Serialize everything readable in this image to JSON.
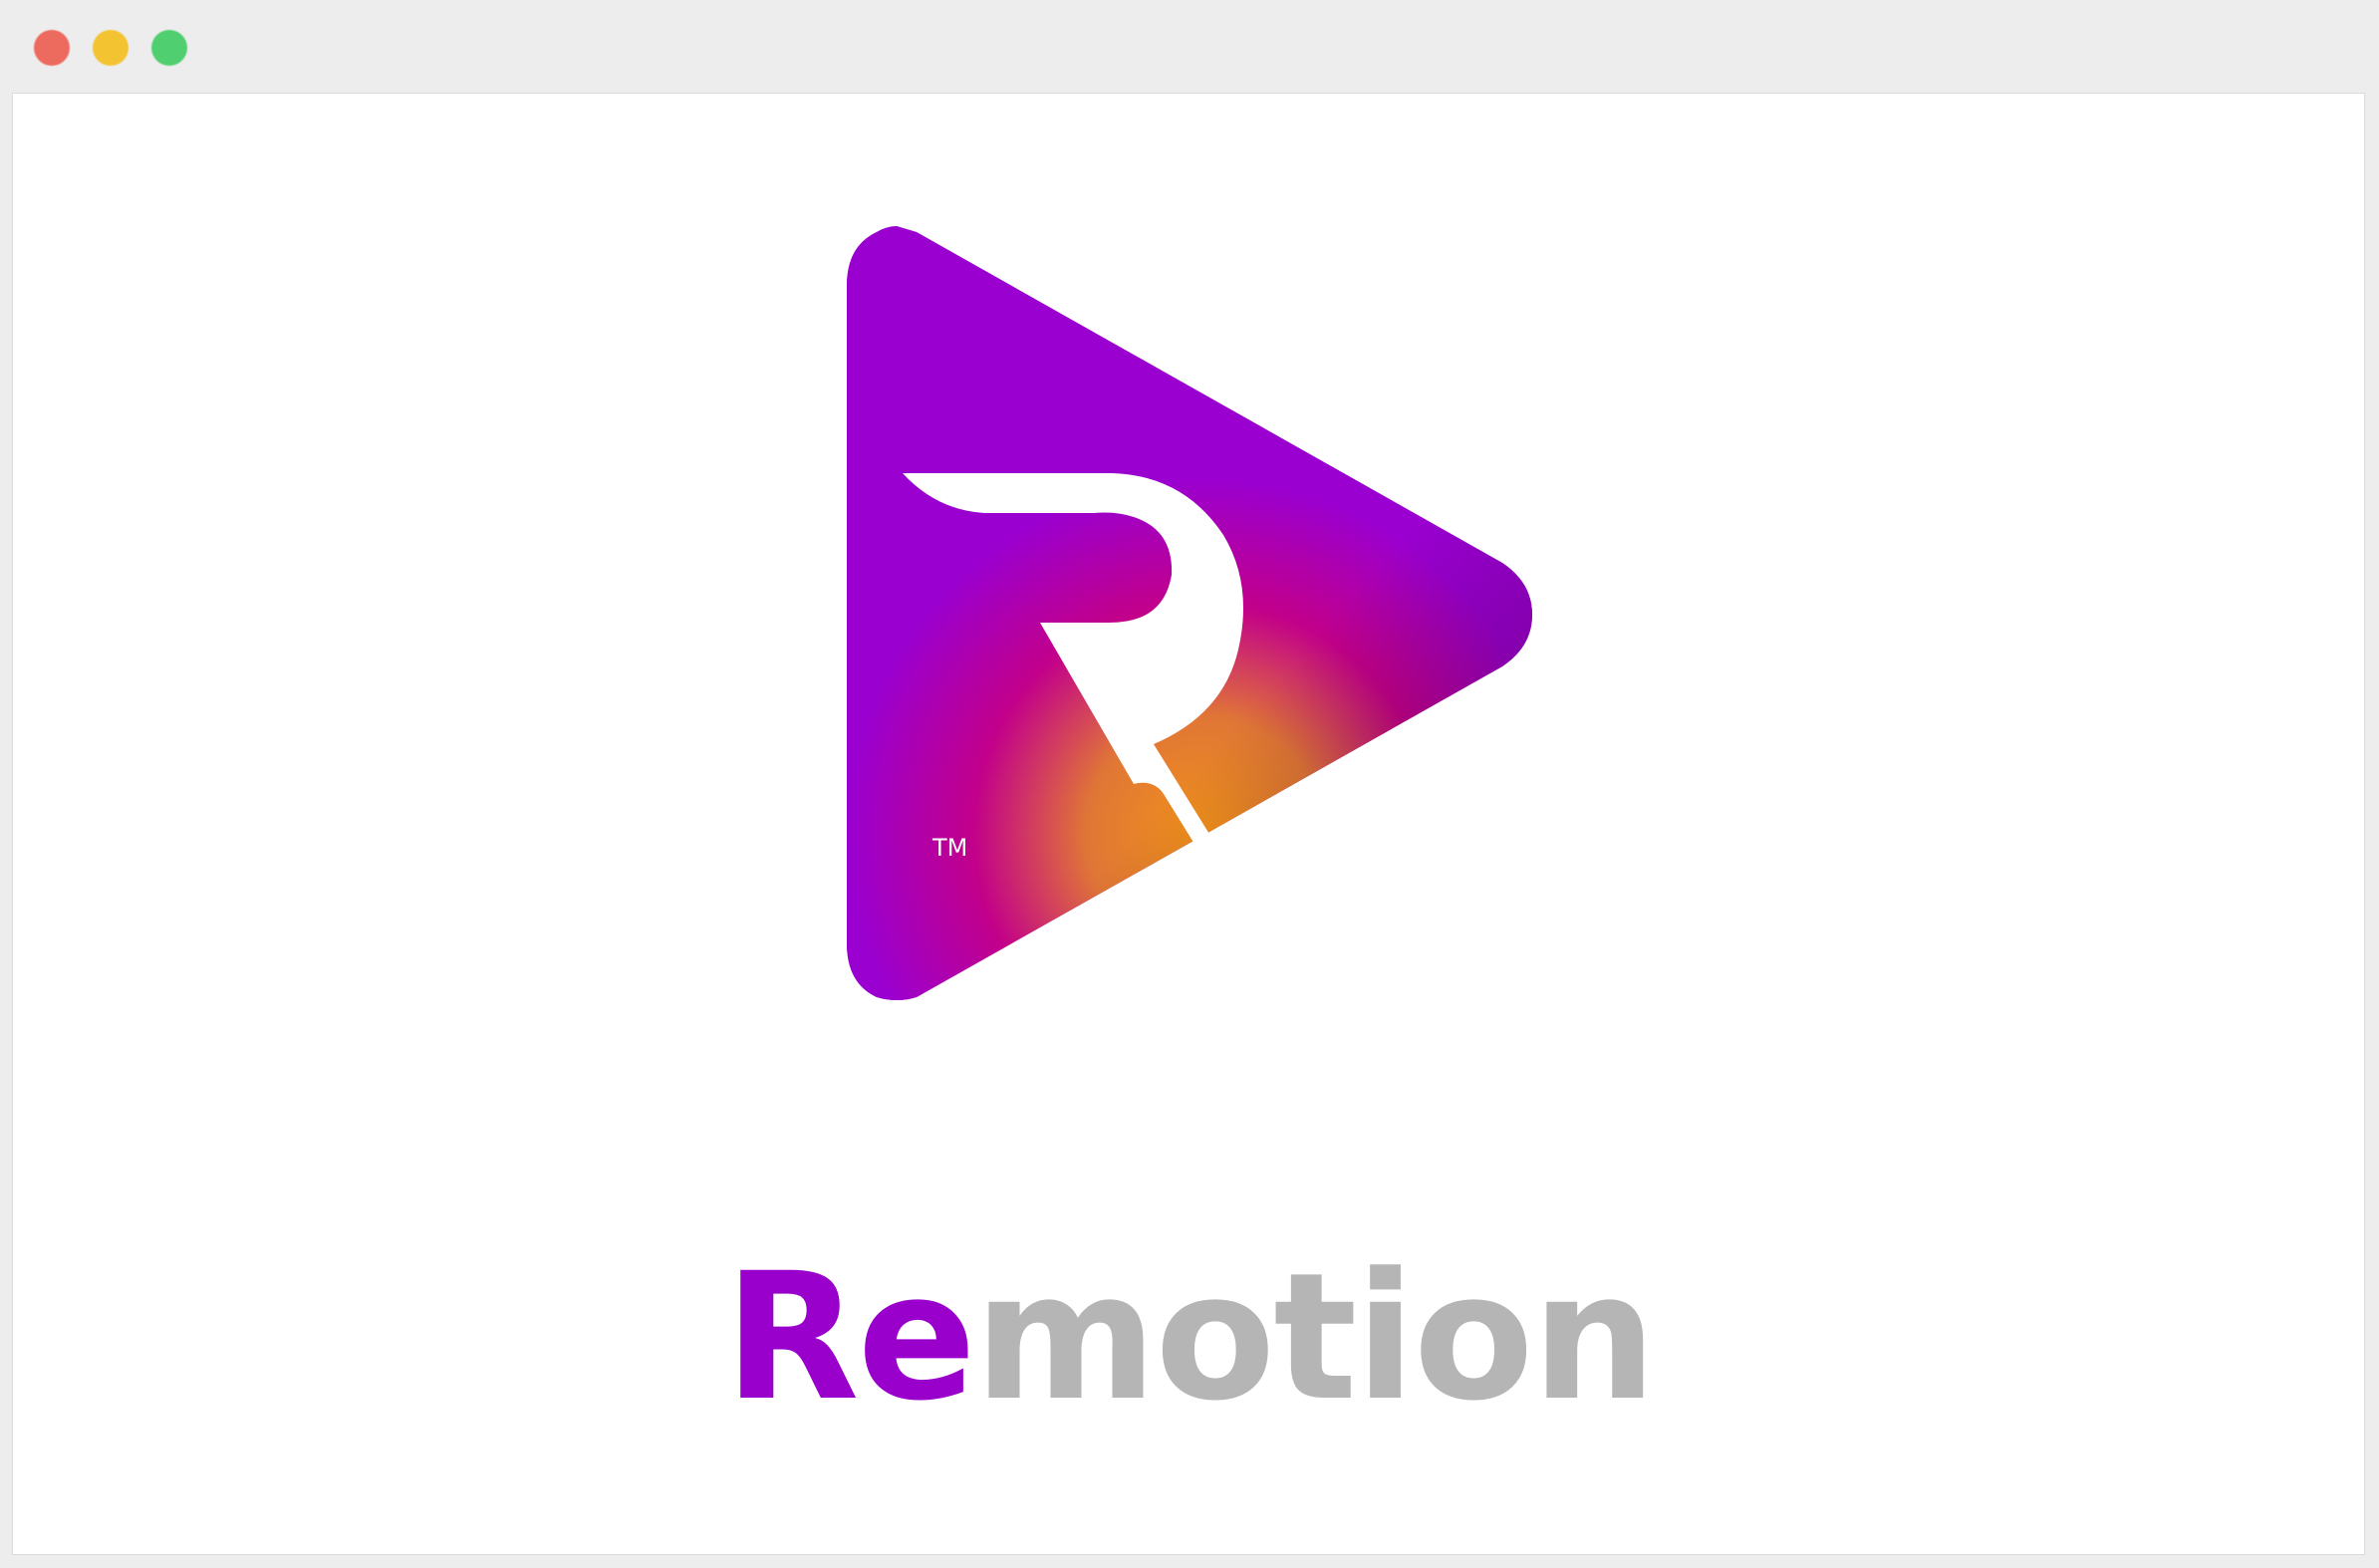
{
  "window": {
    "traffic_lights": {
      "close": "#ed6a5e",
      "minimize": "#f4c331",
      "maximize": "#4fcf70"
    }
  },
  "logo": {
    "trademark": "TM",
    "icon": "remotion-play-r-icon",
    "colors": {
      "purple": "#9a00d0",
      "magenta": "#c2008a",
      "orange": "#f2921a",
      "crimson": "#a3004d"
    }
  },
  "wordmark": {
    "part1": "Re",
    "part2": "motion",
    "color_part1": "#9a00cc",
    "color_part2": "#b5b5b5"
  }
}
